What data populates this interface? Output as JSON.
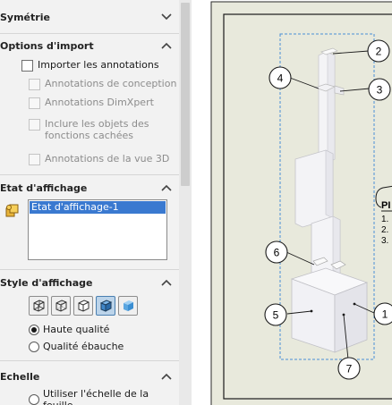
{
  "panel": {
    "sections": {
      "symetrie": {
        "title": "Symétrie"
      },
      "import": {
        "title": "Options d'import",
        "import_annotations": "Importer les annotations",
        "design_annotations": "Annotations de conception",
        "dimxpert_annotations": "Annotations DimXpert",
        "hidden_objects": "Inclure les objets des fonctions cachées",
        "view3d_annotations": "Annotations de la vue 3D"
      },
      "display_state": {
        "title": "Etat d'affichage",
        "items": [
          "Etat d'affichage-1"
        ]
      },
      "display_style": {
        "title": "Style d'affichage",
        "styles": [
          "wireframe-icon",
          "hidden-lines-visible-icon",
          "hidden-lines-removed-icon",
          "shaded-with-edges-icon",
          "shaded-icon"
        ],
        "active_style": "shaded-with-edges-icon",
        "quality_high": "Haute qualité",
        "quality_draft": "Qualité ébauche",
        "selected_quality": "high"
      },
      "scale": {
        "title": "Echelle",
        "use_sheet_scale": "Utiliser l'échelle de la feuille"
      }
    }
  },
  "drawing": {
    "balloons": [
      "1",
      "2",
      "3",
      "4",
      "5",
      "6",
      "7"
    ],
    "table_header": "PI",
    "table_rows": [
      "1.",
      "2.",
      "3."
    ]
  },
  "colors": {
    "panel_bg": "#f2f2f2",
    "sheet_bg": "#e8e9dc",
    "selection_blue": "#3a79d0",
    "bbox_dash": "#4a8fd6"
  }
}
